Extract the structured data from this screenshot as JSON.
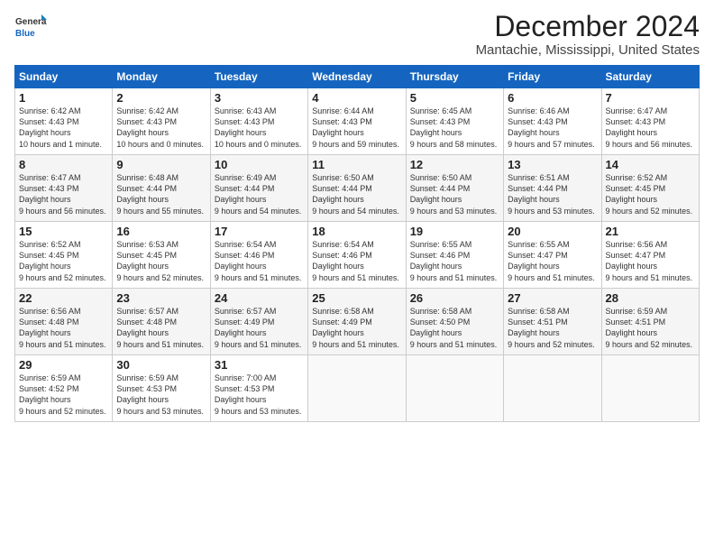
{
  "logo": {
    "line1": "General",
    "line2": "Blue"
  },
  "title": "December 2024",
  "subtitle": "Mantachie, Mississippi, United States",
  "days_of_week": [
    "Sunday",
    "Monday",
    "Tuesday",
    "Wednesday",
    "Thursday",
    "Friday",
    "Saturday"
  ],
  "weeks": [
    [
      {
        "day": "1",
        "sunrise": "6:42 AM",
        "sunset": "4:43 PM",
        "daylight": "10 hours and 1 minute."
      },
      {
        "day": "2",
        "sunrise": "6:42 AM",
        "sunset": "4:43 PM",
        "daylight": "10 hours and 0 minutes."
      },
      {
        "day": "3",
        "sunrise": "6:43 AM",
        "sunset": "4:43 PM",
        "daylight": "10 hours and 0 minutes."
      },
      {
        "day": "4",
        "sunrise": "6:44 AM",
        "sunset": "4:43 PM",
        "daylight": "9 hours and 59 minutes."
      },
      {
        "day": "5",
        "sunrise": "6:45 AM",
        "sunset": "4:43 PM",
        "daylight": "9 hours and 58 minutes."
      },
      {
        "day": "6",
        "sunrise": "6:46 AM",
        "sunset": "4:43 PM",
        "daylight": "9 hours and 57 minutes."
      },
      {
        "day": "7",
        "sunrise": "6:47 AM",
        "sunset": "4:43 PM",
        "daylight": "9 hours and 56 minutes."
      }
    ],
    [
      {
        "day": "8",
        "sunrise": "6:47 AM",
        "sunset": "4:43 PM",
        "daylight": "9 hours and 56 minutes."
      },
      {
        "day": "9",
        "sunrise": "6:48 AM",
        "sunset": "4:44 PM",
        "daylight": "9 hours and 55 minutes."
      },
      {
        "day": "10",
        "sunrise": "6:49 AM",
        "sunset": "4:44 PM",
        "daylight": "9 hours and 54 minutes."
      },
      {
        "day": "11",
        "sunrise": "6:50 AM",
        "sunset": "4:44 PM",
        "daylight": "9 hours and 54 minutes."
      },
      {
        "day": "12",
        "sunrise": "6:50 AM",
        "sunset": "4:44 PM",
        "daylight": "9 hours and 53 minutes."
      },
      {
        "day": "13",
        "sunrise": "6:51 AM",
        "sunset": "4:44 PM",
        "daylight": "9 hours and 53 minutes."
      },
      {
        "day": "14",
        "sunrise": "6:52 AM",
        "sunset": "4:45 PM",
        "daylight": "9 hours and 52 minutes."
      }
    ],
    [
      {
        "day": "15",
        "sunrise": "6:52 AM",
        "sunset": "4:45 PM",
        "daylight": "9 hours and 52 minutes."
      },
      {
        "day": "16",
        "sunrise": "6:53 AM",
        "sunset": "4:45 PM",
        "daylight": "9 hours and 52 minutes."
      },
      {
        "day": "17",
        "sunrise": "6:54 AM",
        "sunset": "4:46 PM",
        "daylight": "9 hours and 51 minutes."
      },
      {
        "day": "18",
        "sunrise": "6:54 AM",
        "sunset": "4:46 PM",
        "daylight": "9 hours and 51 minutes."
      },
      {
        "day": "19",
        "sunrise": "6:55 AM",
        "sunset": "4:46 PM",
        "daylight": "9 hours and 51 minutes."
      },
      {
        "day": "20",
        "sunrise": "6:55 AM",
        "sunset": "4:47 PM",
        "daylight": "9 hours and 51 minutes."
      },
      {
        "day": "21",
        "sunrise": "6:56 AM",
        "sunset": "4:47 PM",
        "daylight": "9 hours and 51 minutes."
      }
    ],
    [
      {
        "day": "22",
        "sunrise": "6:56 AM",
        "sunset": "4:48 PM",
        "daylight": "9 hours and 51 minutes."
      },
      {
        "day": "23",
        "sunrise": "6:57 AM",
        "sunset": "4:48 PM",
        "daylight": "9 hours and 51 minutes."
      },
      {
        "day": "24",
        "sunrise": "6:57 AM",
        "sunset": "4:49 PM",
        "daylight": "9 hours and 51 minutes."
      },
      {
        "day": "25",
        "sunrise": "6:58 AM",
        "sunset": "4:49 PM",
        "daylight": "9 hours and 51 minutes."
      },
      {
        "day": "26",
        "sunrise": "6:58 AM",
        "sunset": "4:50 PM",
        "daylight": "9 hours and 51 minutes."
      },
      {
        "day": "27",
        "sunrise": "6:58 AM",
        "sunset": "4:51 PM",
        "daylight": "9 hours and 52 minutes."
      },
      {
        "day": "28",
        "sunrise": "6:59 AM",
        "sunset": "4:51 PM",
        "daylight": "9 hours and 52 minutes."
      }
    ],
    [
      {
        "day": "29",
        "sunrise": "6:59 AM",
        "sunset": "4:52 PM",
        "daylight": "9 hours and 52 minutes."
      },
      {
        "day": "30",
        "sunrise": "6:59 AM",
        "sunset": "4:53 PM",
        "daylight": "9 hours and 53 minutes."
      },
      {
        "day": "31",
        "sunrise": "7:00 AM",
        "sunset": "4:53 PM",
        "daylight": "9 hours and 53 minutes."
      },
      null,
      null,
      null,
      null
    ]
  ]
}
